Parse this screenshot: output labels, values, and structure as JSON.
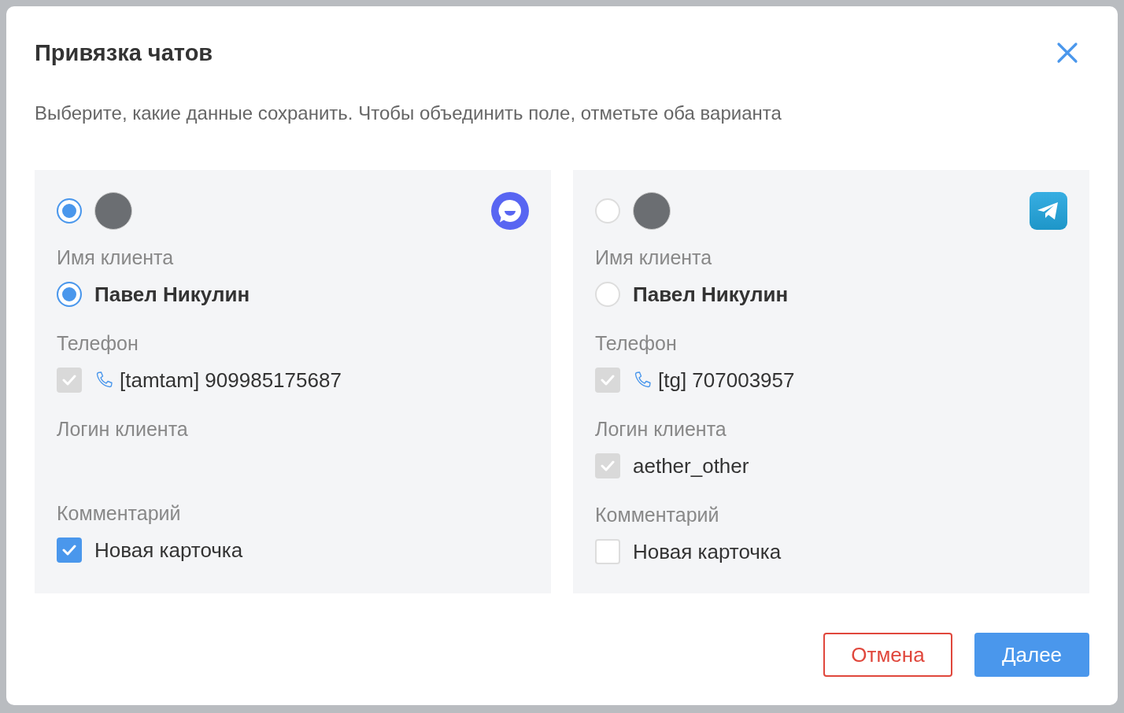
{
  "dialog": {
    "title": "Привязка чатов",
    "subtitle": "Выберите, какие данные сохранить. Чтобы объединить поле, отметьте оба варианта"
  },
  "sources": [
    {
      "selected": true,
      "kind": "tamtam",
      "sections": [
        {
          "label": "Имя клиента",
          "items": [
            {
              "kind": "radio",
              "text": "Павел Никулин",
              "selected": true
            }
          ]
        },
        {
          "label": "Телефон",
          "items": [
            {
              "kind": "phone",
              "text": "[tamtam] 909985175687",
              "checked": true,
              "disabled": true
            }
          ]
        },
        {
          "label": "Логин клиента"
        },
        {
          "label": "Комментарий",
          "items": [
            {
              "kind": "checkbox",
              "text": "Новая карточка",
              "checked": true,
              "disabled": false
            }
          ]
        }
      ]
    },
    {
      "selected": false,
      "kind": "telegram",
      "sections": [
        {
          "label": "Имя клиента",
          "items": [
            {
              "kind": "radio",
              "text": "Павел Никулин",
              "selected": false
            }
          ]
        },
        {
          "label": "Телефон",
          "items": [
            {
              "kind": "phone",
              "text": "[tg] 707003957",
              "checked": true,
              "disabled": true
            }
          ]
        },
        {
          "label": "Логин клиента",
          "items": [
            {
              "kind": "checkbox",
              "text": "aether_other",
              "checked": true,
              "disabled": true
            }
          ]
        },
        {
          "label": "Комментарий",
          "items": [
            {
              "kind": "checkbox",
              "text": "Новая карточка",
              "checked": false,
              "disabled": false
            }
          ]
        }
      ]
    }
  ],
  "buttons": {
    "cancel": "Отмена",
    "next": "Далее"
  }
}
